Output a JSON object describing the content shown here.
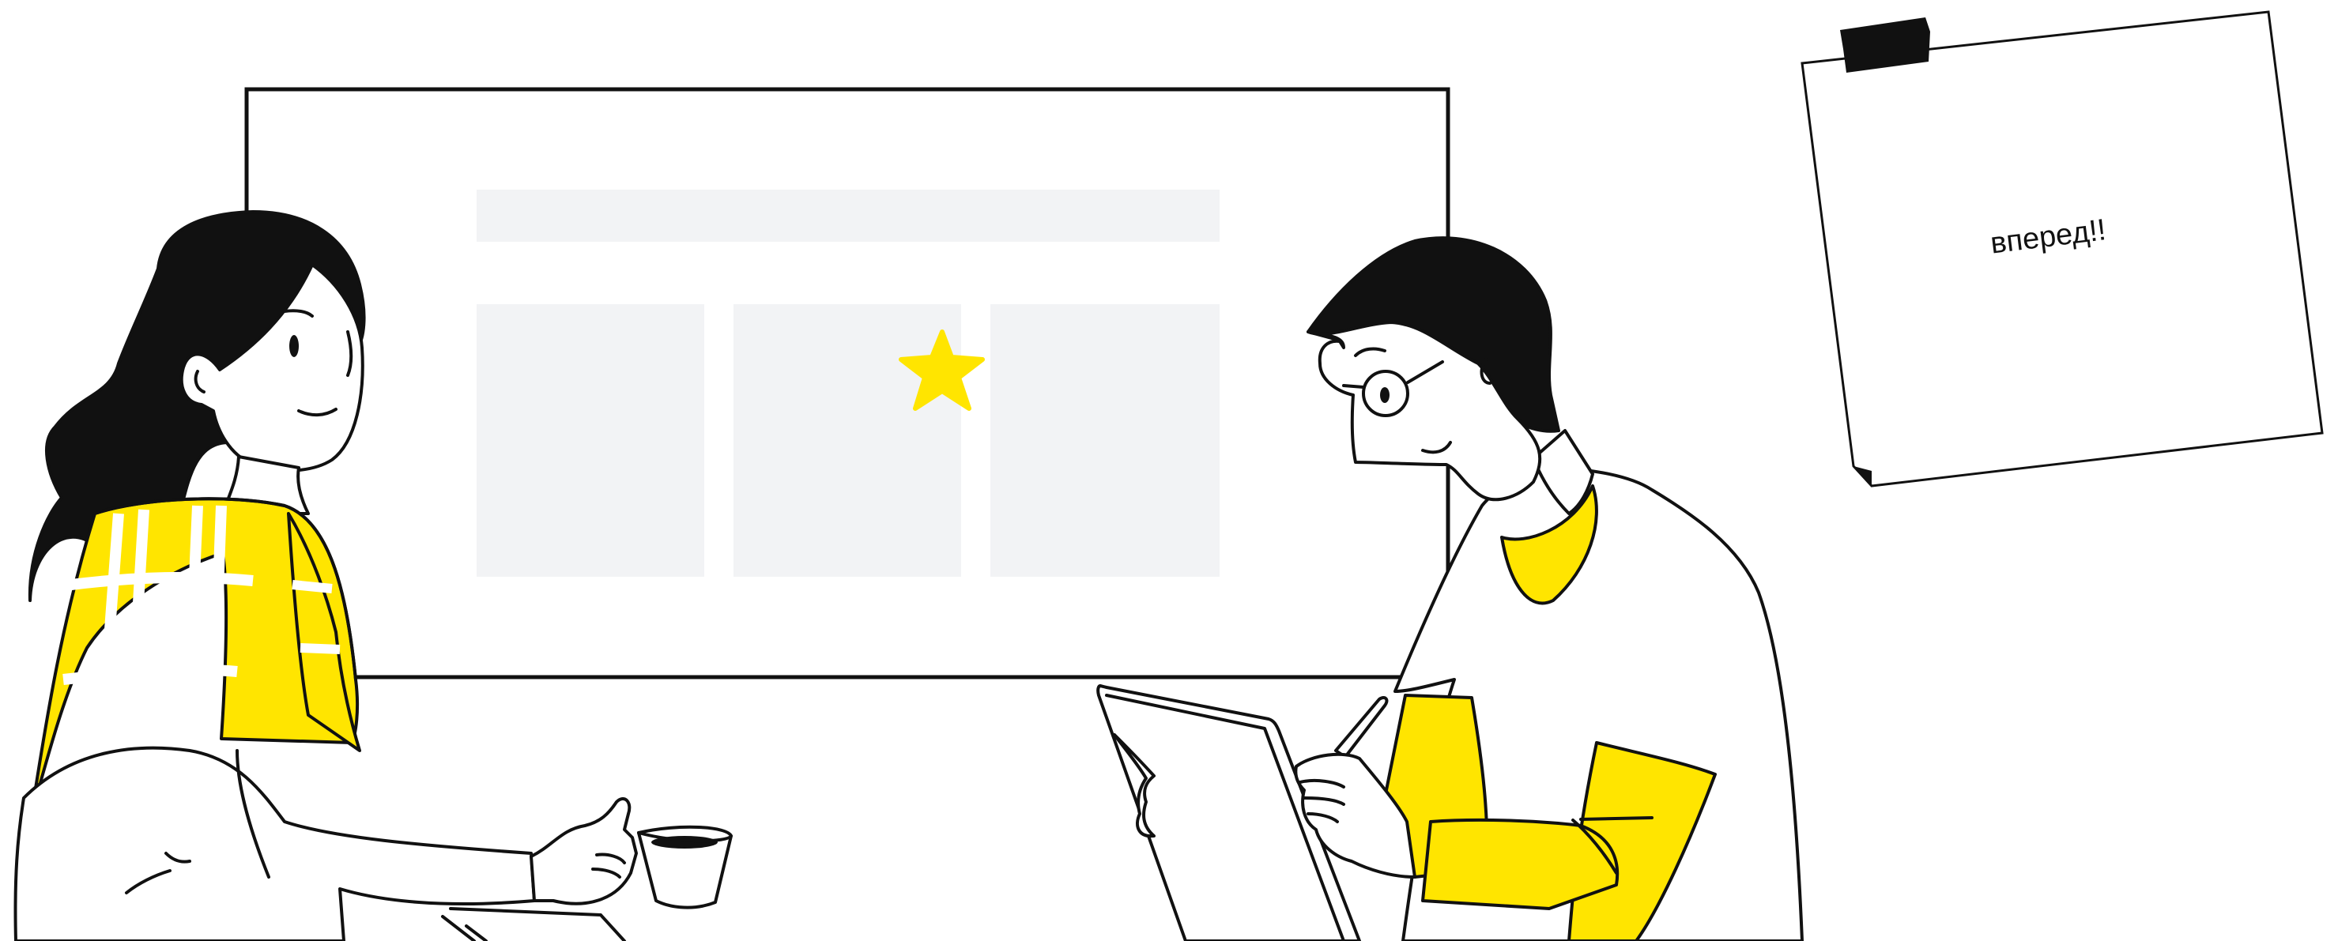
{
  "sticky_note": {
    "text": "вперед!!"
  },
  "colors": {
    "accent": "#FFE500",
    "ink": "#111111",
    "placeholder": "#F2F3F5",
    "background": "#FFFFFF"
  },
  "icons": [
    "star-icon",
    "tape-icon",
    "coffee-cup-icon",
    "tablet-icon",
    "pen-icon"
  ]
}
